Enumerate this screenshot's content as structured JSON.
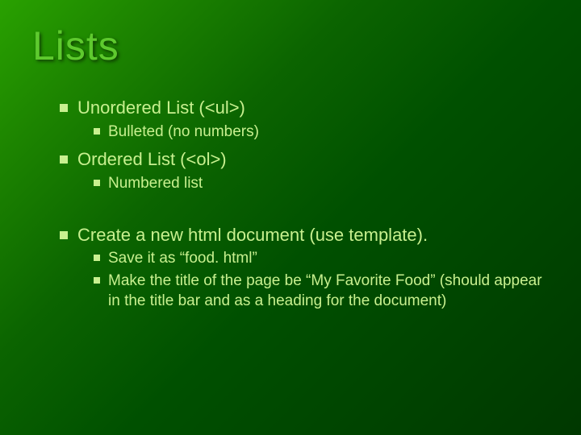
{
  "title": "Lists",
  "items": {
    "i0": "Unordered List (<ul>)",
    "i0a": "Bulleted (no numbers)",
    "i1": "Ordered List (<ol>)",
    "i1a": "Numbered list",
    "i2": "Create a new html document (use template).",
    "i2a": "Save it as “food. html”",
    "i2b": "Make the title of the page be “My Favorite Food” (should appear in the title bar and as a heading for the document)"
  }
}
